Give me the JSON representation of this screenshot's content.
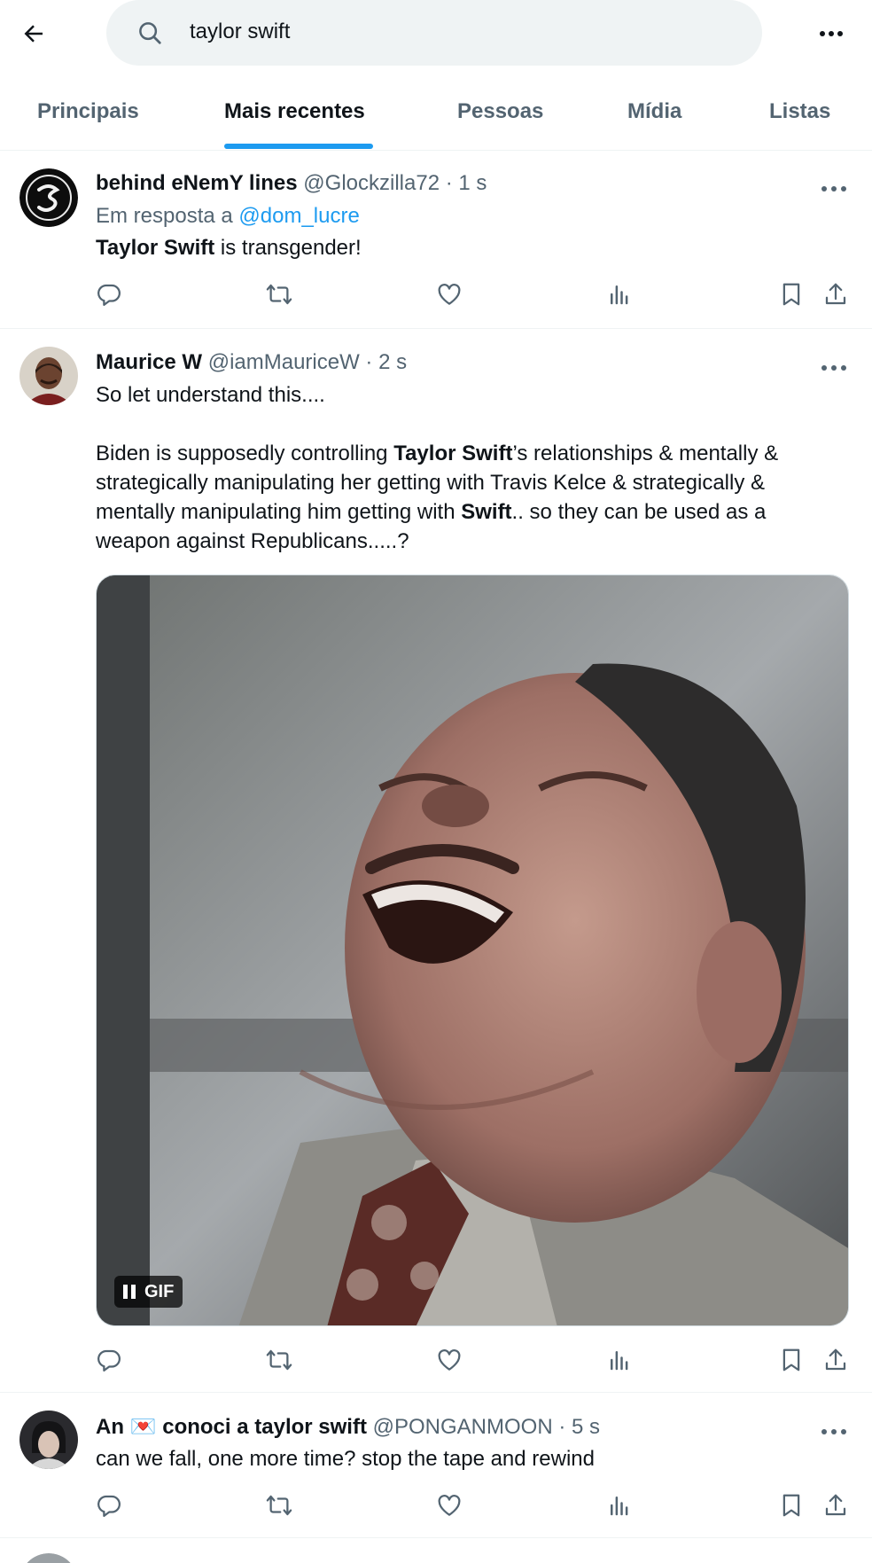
{
  "search": {
    "query": "taylor swift"
  },
  "tabs": [
    {
      "label": "Principais"
    },
    {
      "label": "Mais recentes"
    },
    {
      "label": "Pessoas"
    },
    {
      "label": "Mídia"
    },
    {
      "label": "Listas"
    }
  ],
  "posts": [
    {
      "name": "behind eNemY lines",
      "handle": "@Glockzilla72",
      "time": "· 1 s",
      "reply_prefix": "Em resposta a",
      "reply_handle": "@dom_lucre",
      "text_bold": "Taylor Swift",
      "text_rest": " is transgender!"
    },
    {
      "name": "Maurice W",
      "handle": "@iamMauriceW",
      "time": "· 2 s",
      "line1": "So let understand this....",
      "p2_a": "Biden is supposedly controlling ",
      "p2_b": "Taylor Swift",
      "p2_c": "’s relationships & mentally & strategically manipulating her getting with Travis Kelce & strategically & mentally manipulating him getting with ",
      "p2_d": "Swift",
      "p2_e": ".. so they can be used as a weapon against Republicans.....?",
      "media_badge": "GIF"
    },
    {
      "name_a": "An ",
      "name_emoji": "💌",
      "name_b": " conoci a taylor swift",
      "handle": "@PONGANMOON",
      "time": "· 5 s",
      "text": "can we fall, one more time? stop the tape and rewind"
    }
  ],
  "colors": {
    "accent": "#1d9bf0",
    "muted": "#536471",
    "text": "#0f1419",
    "search_bg": "#eff3f4"
  },
  "icons": [
    "back-arrow-icon",
    "search-icon",
    "more-icon",
    "reply-icon",
    "retweet-icon",
    "like-icon",
    "views-icon",
    "bookmark-icon",
    "share-icon"
  ]
}
